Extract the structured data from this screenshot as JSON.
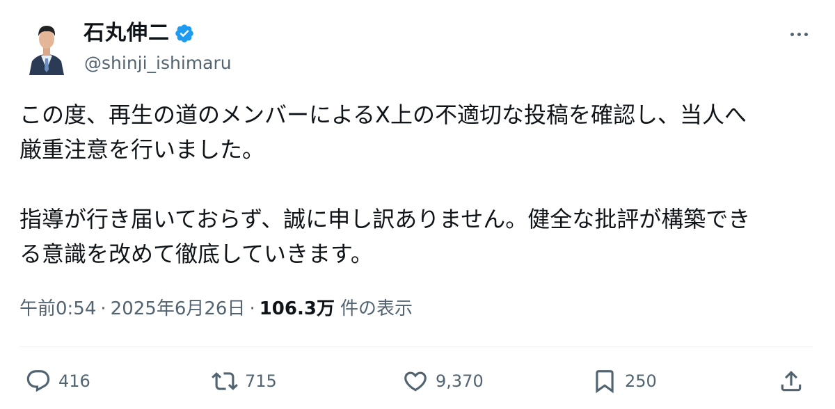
{
  "author": {
    "display_name": "石丸伸二",
    "handle": "@shinji_ishimaru",
    "verified_icon": "verified-badge-icon",
    "verified_color": "#1d9bf0"
  },
  "tweet": {
    "paragraphs": [
      {
        "lines": [
          "この度、再生の道のメンバーによるX上の不適切な投稿を確認し、当人へ",
          "厳重注意を行いました。"
        ]
      },
      {
        "lines": [
          "指導が行き届いておらず、誠に申し訳ありません。健全な批評が構築でき",
          "る意識を改めて徹底していきます。"
        ]
      }
    ]
  },
  "meta": {
    "time": "午前0:54",
    "separator": "·",
    "date": "2025年6月26日",
    "views_count": "106.3万",
    "views_label": "件の表示"
  },
  "actions": {
    "reply": {
      "icon": "reply-icon",
      "count": "416"
    },
    "repost": {
      "icon": "repost-icon",
      "count": "715"
    },
    "like": {
      "icon": "heart-icon",
      "count": "9,370"
    },
    "bookmark": {
      "icon": "bookmark-icon",
      "count": "250"
    },
    "share": {
      "icon": "share-icon"
    }
  },
  "colors": {
    "text_primary": "#0f1419",
    "text_secondary": "#536471",
    "divider": "#eff3f4",
    "accent": "#1d9bf0"
  }
}
